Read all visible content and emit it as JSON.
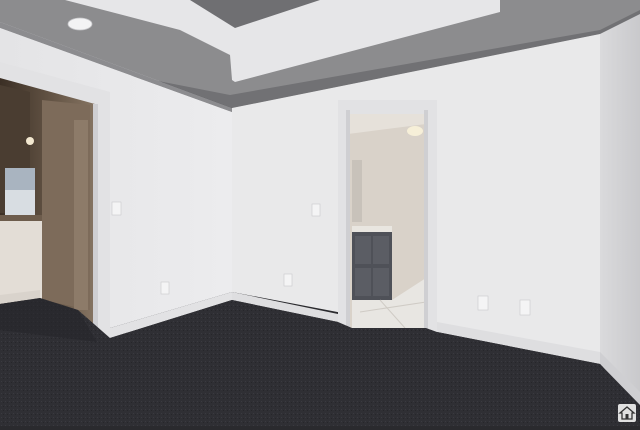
{
  "photo": {
    "scene": "empty-bedroom-interior",
    "colors": {
      "wall": "#e9e9ea",
      "wall_shadow": "#d6d6d8",
      "ceiling": "#dcdcde",
      "tray_band": "#7e7e80",
      "carpet": "#2f2f34",
      "trim": "#e2e2e4",
      "vanity": "#4f5158",
      "bath_wall": "#d9d2c9",
      "closet_dark": "#3a3128"
    },
    "watermark_icon": "house-icon"
  }
}
